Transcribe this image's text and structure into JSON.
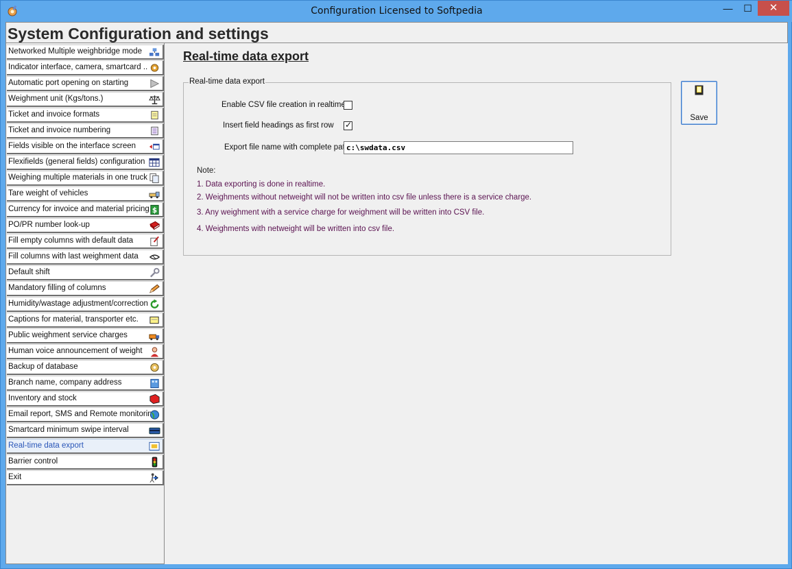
{
  "window": {
    "title": "Configuration  Licensed to Softpedia",
    "controls": {
      "minimize": "—",
      "maximize": "☐",
      "close": "✕"
    }
  },
  "header": {
    "title": "System Configuration and settings"
  },
  "sidebar": {
    "items": [
      {
        "label": "Networked Multiple weighbridge mode",
        "icon": "network-computers-icon"
      },
      {
        "label": "Indicator interface, camera, smartcard ..",
        "icon": "gear-icon"
      },
      {
        "label": "Automatic port opening on starting",
        "icon": "arrow-right-icon"
      },
      {
        "label": "Weighment unit (Kgs/tons.)",
        "icon": "balance-scale-icon"
      },
      {
        "label": "Ticket and invoice formats",
        "icon": "document-icon"
      },
      {
        "label": "Ticket and invoice numbering",
        "icon": "numbered-document-icon"
      },
      {
        "label": "Fields visible on the interface screen",
        "icon": "window-arrow-icon"
      },
      {
        "label": "Flexifields (general fields) configuration",
        "icon": "table-grid-icon"
      },
      {
        "label": "Weighing multiple materials in one truck",
        "icon": "copy-documents-icon"
      },
      {
        "label": "Tare weight of vehicles",
        "icon": "truck-icon"
      },
      {
        "label": "Currency for invoice and material pricing",
        "icon": "dollar-icon"
      },
      {
        "label": "PO/PR number look-up",
        "icon": "book-icon"
      },
      {
        "label": "Fill empty columns with default data",
        "icon": "edit-note-icon"
      },
      {
        "label": "Fill columns with last weighment data",
        "icon": "handshake-icon"
      },
      {
        "label": "Default shift",
        "icon": "wrench-icon"
      },
      {
        "label": "Mandatory filling of columns",
        "icon": "pencil-icon"
      },
      {
        "label": "Humidity/wastage adjustment/correction",
        "icon": "refresh-icon"
      },
      {
        "label": "Captions for material, transporter etc.",
        "icon": "scroll-icon"
      },
      {
        "label": "Public weighment service charges",
        "icon": "truck-orange-icon"
      },
      {
        "label": "Human voice announcement of weight",
        "icon": "person-icon"
      },
      {
        "label": "Backup of database",
        "icon": "backup-disk-icon"
      },
      {
        "label": "Branch name, company address",
        "icon": "building-icon"
      },
      {
        "label": "Inventory and stock",
        "icon": "inventory-icon"
      },
      {
        "label": "Email report, SMS and Remote monitoring",
        "icon": "globe-icon"
      },
      {
        "label": "Smartcard minimum swipe interval",
        "icon": "card-icon"
      },
      {
        "label": "Real-time data export",
        "icon": "export-icon",
        "active": true
      },
      {
        "label": "Barrier control",
        "icon": "traffic-light-icon"
      },
      {
        "label": "Exit",
        "icon": "exit-person-icon"
      }
    ]
  },
  "main": {
    "heading": "Real-time data export",
    "group": {
      "legend": "Real-time data export",
      "enable_csv": {
        "label": "Enable CSV file creation in realtime",
        "checked": false
      },
      "insert_headings": {
        "label": "Insert field headings as  first row",
        "checked": true
      },
      "export_path": {
        "label": "Export file name with complete path :",
        "value": "c:\\swdata.csv"
      },
      "note": {
        "title": "Note:",
        "lines": [
          "1. Data exporting is done in realtime.",
          "2. Weighments without netweight will not be written into csv file unless there is  a service charge.",
          "3. Any weighment with a service charge for weighment will be written into CSV file.",
          "4. Weighments with  netweight will be written into csv file."
        ]
      }
    },
    "save": {
      "label": "Save"
    }
  }
}
